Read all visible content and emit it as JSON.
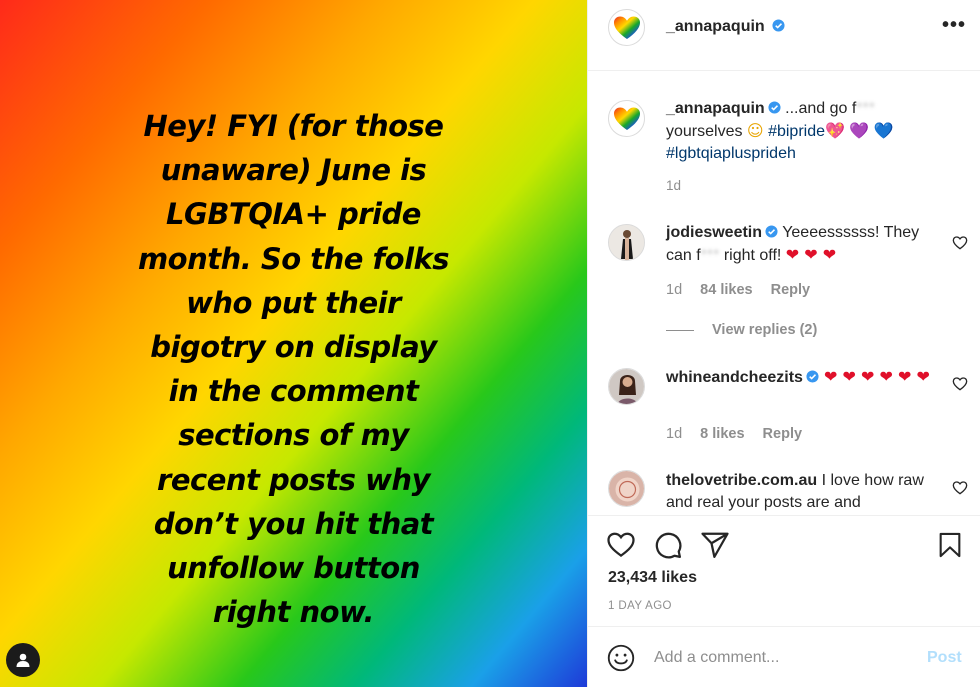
{
  "post": {
    "image_text": "Hey! FYI (for those\nunaware) June is\nLGBTQIA+ pride\nmonth.  So the folks\nwho put their\nbigotry on display\nin the comment\nsections of my\nrecent posts why\ndon’t you hit that\nunfollow button\nright now.",
    "gradient_colors": [
      "#ff2a1a",
      "#ff6a00",
      "#ffa800",
      "#ffd600",
      "#28c81a",
      "#1aa0e8",
      "#1e3ad8"
    ]
  },
  "header": {
    "username": "_annapaquin",
    "more_label": "•••"
  },
  "caption": {
    "username": "_annapaquin",
    "text_start": " ...and go f",
    "text_blur": "***",
    "text_line2": "yourselves ",
    "emoji_relieved": "☺",
    "hashtag1": "#bipride",
    "emoji_hearts": [
      "💖",
      "💜",
      "💙"
    ],
    "hashtag2": "#lgbtqiaplusprideh",
    "time": "1d"
  },
  "comments": [
    {
      "username": "jodiesweetin",
      "text_a": " Yeeeessssss! They can f",
      "text_blur": "***",
      "text_b": " right off! ",
      "hearts": "❤ ❤ ❤",
      "time": "1d",
      "likes": "84 likes",
      "reply": "Reply",
      "view_replies": "View replies (2)"
    },
    {
      "username": "whineandcheezits",
      "hearts": " ❤ ❤ ❤ ❤ ❤ ❤",
      "time": "1d",
      "likes": "8 likes",
      "reply": "Reply"
    },
    {
      "username": "thelovetribe.com.au",
      "text": " I love how raw and real your posts are and"
    }
  ],
  "actions": {
    "likes": "23,434 likes",
    "time_ago": "1 DAY AGO"
  },
  "add_comment": {
    "placeholder": "Add a comment...",
    "post_label": "Post"
  },
  "colors": {
    "accent_blue": "#0095f6",
    "verified_blue": "#3897f0",
    "hashtag_blue": "#00376b",
    "muted_gray": "#8e8e8e"
  }
}
